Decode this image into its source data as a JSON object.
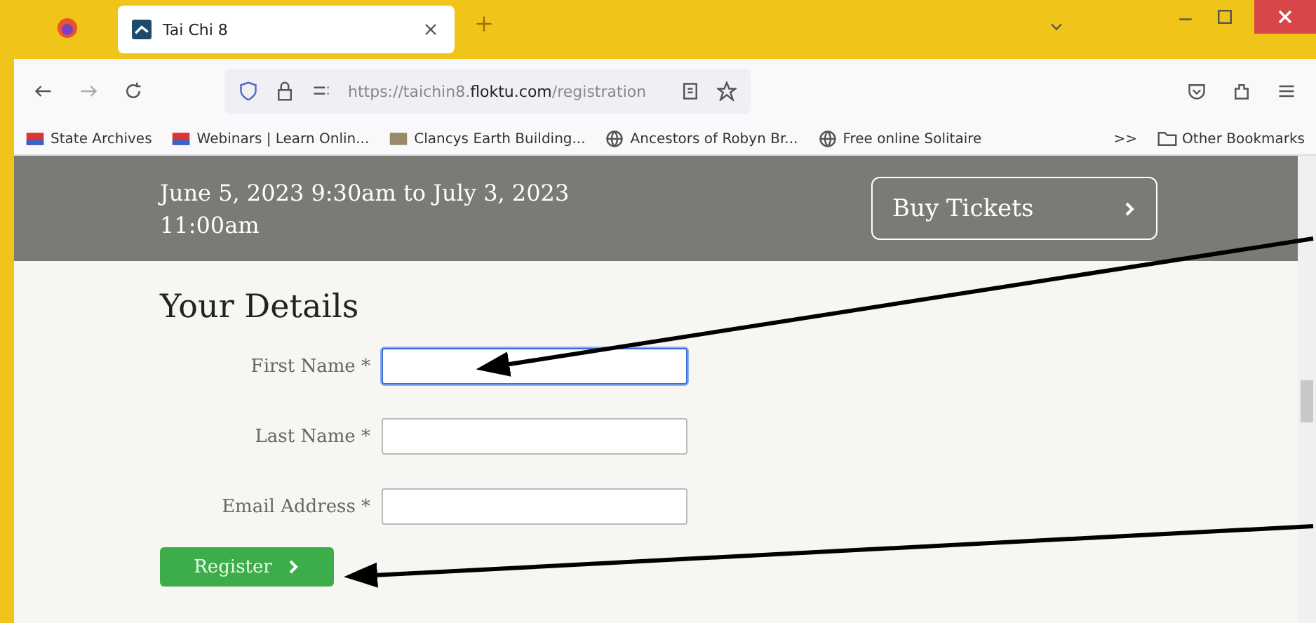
{
  "tab": {
    "title": "Tai Chi 8"
  },
  "address": {
    "url_prefix": "https://taichin8.",
    "url_domain": "floktu.com",
    "url_path": "/registration"
  },
  "bookmarks": [
    {
      "label": "State Archives",
      "kind": "flag"
    },
    {
      "label": "Webinars | Learn Onlin...",
      "kind": "flag"
    },
    {
      "label": "Clancys Earth Building...",
      "kind": "photo"
    },
    {
      "label": "Ancestors of Robyn Br...",
      "kind": "globe"
    },
    {
      "label": "Free online Solitaire",
      "kind": "globe"
    }
  ],
  "bookmarks_overflow": ">>",
  "other_bookmarks": "Other Bookmarks",
  "banner": {
    "date": "June 5, 2023 9:30am to July 3, 2023",
    "time": "11:00am",
    "button": "Buy Tickets"
  },
  "form": {
    "heading": "Your Details",
    "fields": [
      {
        "label": "First Name *",
        "focused": true
      },
      {
        "label": "Last Name *",
        "focused": false
      },
      {
        "label": "Email Address *",
        "focused": false
      }
    ],
    "submit": "Register"
  }
}
